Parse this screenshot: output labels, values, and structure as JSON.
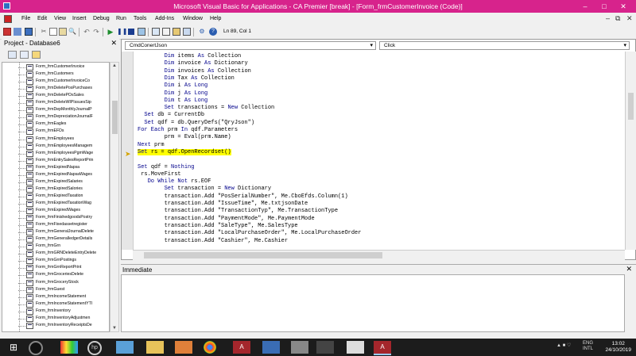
{
  "window": {
    "title": "Microsoft Visual Basic for Applications - CA Premier [break] - [Form_frmCustomerInvoice (Code)]"
  },
  "menu": [
    "File",
    "Edit",
    "View",
    "Insert",
    "Debug",
    "Run",
    "Tools",
    "Add-Ins",
    "Window",
    "Help"
  ],
  "toolbar": {
    "position": "Ln 89, Col 1"
  },
  "project": {
    "title": "Project - Database6",
    "items": [
      "Form_frmCustomerInvoice",
      "Form_frmCustomers",
      "Form_frmCustomerInvoiceCo",
      "Form_frmDeletePosPurchases",
      "Form_frmDeletePOsSales",
      "Form_frmDeleteWIPIssuesSip",
      "Form_frmDepMonthlyJournalP",
      "Form_frmDepreciationJournalF",
      "Form_frmEagles",
      "Form_frmEFDs",
      "Form_frmEmployees",
      "Form_frmEmployeesManagem",
      "Form_frmEmployeesPgmWage",
      "Form_frmEntrySalesReportPrin",
      "Form_frmExpiredNapsa",
      "Form_frmExpiredNapsaWages",
      "Form_frmExpiredSalaries",
      "Form_frmExpiredSalories",
      "Form_frmExpiredTaxation",
      "Form_frmExpiredTaxationWag",
      "Form_frmExpiredWages",
      "Form_frmFinishedgoodsPostry",
      "Form_frmFixedassetregister",
      "Form_frmGeneralJournalDelete",
      "Form_frmGeneralledgerDetails",
      "Form_frmGrn",
      "Form_frmGRNDeleteEntryDelete",
      "Form_frmGrnPostings",
      "Form_frmGrnReportPrint",
      "Form_frmGroceriesDelete",
      "Form_frmGroceryStock",
      "Form_frmGuest",
      "Form_frmIncomeStatement",
      "Form_frmIncomeStatementYTI",
      "Form_frmInventory",
      "Form_frmInventoryAdjustmen",
      "Form_frmInventoryReceiptsDe"
    ]
  },
  "code": {
    "object_combo": "CmdConertJson",
    "proc_combo": "Click",
    "lines": [
      {
        "indent": "        ",
        "parts": [
          [
            "kw",
            "Dim "
          ],
          [
            "t",
            "items "
          ],
          [
            "kw",
            "As "
          ],
          [
            "t",
            "Collection"
          ]
        ]
      },
      {
        "indent": "        ",
        "parts": [
          [
            "kw",
            "Dim "
          ],
          [
            "t",
            "invoice "
          ],
          [
            "kw",
            "As "
          ],
          [
            "t",
            "Dictionary"
          ]
        ]
      },
      {
        "indent": "        ",
        "parts": [
          [
            "kw",
            "Dim "
          ],
          [
            "t",
            "invoices "
          ],
          [
            "kw",
            "As "
          ],
          [
            "t",
            "Collection"
          ]
        ]
      },
      {
        "indent": "        ",
        "parts": [
          [
            "kw",
            "Dim "
          ],
          [
            "t",
            "Tax "
          ],
          [
            "kw",
            "As "
          ],
          [
            "t",
            "Collection"
          ]
        ]
      },
      {
        "indent": "        ",
        "parts": [
          [
            "kw",
            "Dim "
          ],
          [
            "t",
            "i "
          ],
          [
            "kw",
            "As Long"
          ]
        ]
      },
      {
        "indent": "        ",
        "parts": [
          [
            "kw",
            "Dim "
          ],
          [
            "t",
            "j "
          ],
          [
            "kw",
            "As Long"
          ]
        ]
      },
      {
        "indent": "        ",
        "parts": [
          [
            "kw",
            "Dim "
          ],
          [
            "t",
            "t "
          ],
          [
            "kw",
            "As Long"
          ]
        ]
      },
      {
        "indent": "        ",
        "parts": [
          [
            "kw",
            "Set "
          ],
          [
            "t",
            "transactions = "
          ],
          [
            "kw",
            "New "
          ],
          [
            "t",
            "Collection"
          ]
        ]
      },
      {
        "indent": "  ",
        "parts": [
          [
            "kw",
            "Set "
          ],
          [
            "t",
            "db = CurrentDb"
          ]
        ]
      },
      {
        "indent": "  ",
        "parts": [
          [
            "kw",
            "Set "
          ],
          [
            "t",
            "qdf = db.QueryDefs(\"QryJson\")"
          ]
        ]
      },
      {
        "indent": "",
        "parts": [
          [
            "kw",
            "For Each "
          ],
          [
            "t",
            "prm "
          ],
          [
            "kw",
            "In "
          ],
          [
            "t",
            "qdf.Parameters"
          ]
        ]
      },
      {
        "indent": "        ",
        "parts": [
          [
            "t",
            "prm = Eval(prm.Name)"
          ]
        ]
      },
      {
        "indent": "",
        "parts": [
          [
            "kw",
            "Next "
          ],
          [
            "t",
            "prm"
          ]
        ]
      },
      {
        "indent": "",
        "highlight": true,
        "parts": [
          [
            "kw",
            "Set "
          ],
          [
            "t",
            "rs = qdf.OpenRecordset()"
          ]
        ]
      },
      {
        "indent": "",
        "parts": [
          [
            "t",
            ""
          ]
        ]
      },
      {
        "indent": "",
        "parts": [
          [
            "kw",
            "Set "
          ],
          [
            "t",
            "qdf = "
          ],
          [
            "kw",
            "Nothing"
          ]
        ]
      },
      {
        "indent": " ",
        "parts": [
          [
            "t",
            "rs.MoveFirst"
          ]
        ]
      },
      {
        "indent": "   ",
        "parts": [
          [
            "kw",
            "Do While Not "
          ],
          [
            "t",
            "rs.EOF"
          ]
        ]
      },
      {
        "indent": "        ",
        "parts": [
          [
            "kw",
            "Set "
          ],
          [
            "t",
            "transaction = "
          ],
          [
            "kw",
            "New "
          ],
          [
            "t",
            "Dictionary"
          ]
        ]
      },
      {
        "indent": "        ",
        "parts": [
          [
            "t",
            "transaction.Add \"PosSerialNumber\", Me.CboEfds.Column(1)"
          ]
        ]
      },
      {
        "indent": "        ",
        "parts": [
          [
            "t",
            "transaction.Add \"IssueTime\", Me.txtjsonDate"
          ]
        ]
      },
      {
        "indent": "        ",
        "parts": [
          [
            "t",
            "transaction.Add \"TransactionTyp\", Me.TransactionType"
          ]
        ]
      },
      {
        "indent": "        ",
        "parts": [
          [
            "t",
            "transaction.Add \"PaymentMode\", Me.PaymentMode"
          ]
        ]
      },
      {
        "indent": "        ",
        "parts": [
          [
            "t",
            "transaction.Add \"SaleType\", Me.SalesType"
          ]
        ]
      },
      {
        "indent": "        ",
        "parts": [
          [
            "t",
            "transaction.Add \"LocalPurchaseOrder\", Me.LocalPurchaseOrder"
          ]
        ]
      },
      {
        "indent": "        ",
        "parts": [
          [
            "t",
            "transaction.Add \"Cashier\", Me.Cashier"
          ]
        ]
      }
    ]
  },
  "immediate": {
    "title": "Immediate"
  },
  "taskbar": {
    "lang_top": "ENG",
    "lang_bottom": "INTL",
    "time": "13:02",
    "date": "24/10/2019"
  }
}
